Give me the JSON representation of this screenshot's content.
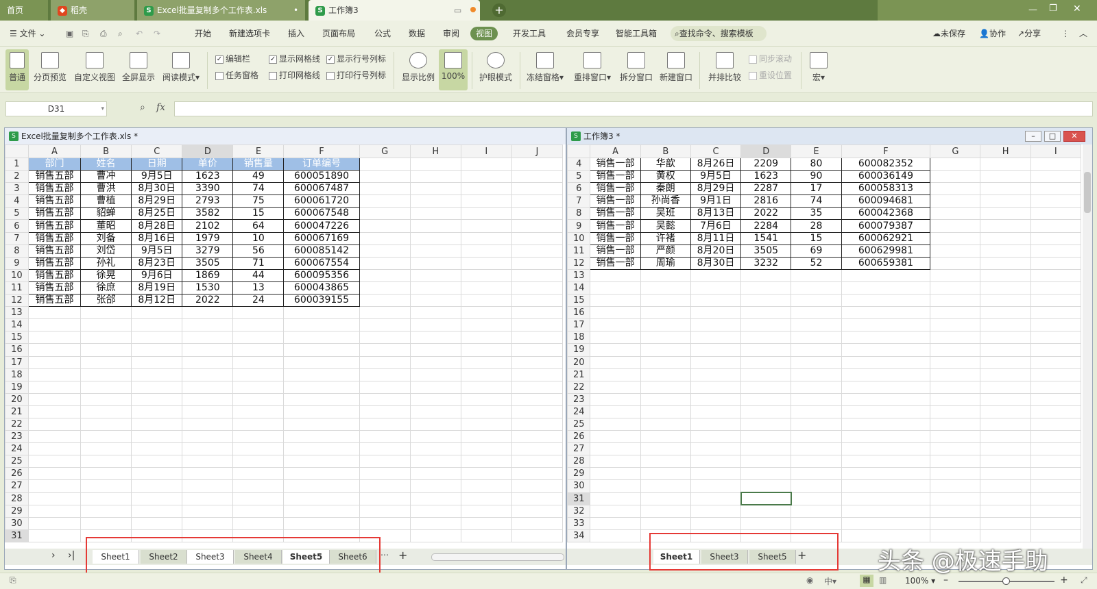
{
  "tabs": [
    {
      "label": "首页"
    },
    {
      "label": "稻壳"
    },
    {
      "label": "Excel批量复制多个工作表.xls"
    },
    {
      "label": "工作簿3"
    }
  ],
  "menu": [
    "文件",
    "开始",
    "新建选项卡",
    "插入",
    "页面布局",
    "公式",
    "数据",
    "审阅",
    "视图",
    "开发工具",
    "会员专享",
    "智能工具箱"
  ],
  "menu_active": "视图",
  "search_label": "查找命令、搜索模板",
  "right_actions": [
    "未保存",
    "协作",
    "分享"
  ],
  "ribbon": {
    "buttons": [
      "普通",
      "分页预览",
      "自定义视图",
      "全屏显示",
      "阅读模式",
      "显示比例",
      "100%",
      "护眼模式",
      "冻结窗格",
      "重排窗口",
      "拆分窗口",
      "新建窗口",
      "并排比较",
      "宏"
    ],
    "checks": [
      {
        "label": "编辑栏",
        "checked": true
      },
      {
        "label": "显示网格线",
        "checked": true
      },
      {
        "label": "显示行号列标",
        "checked": true
      },
      {
        "label": "任务窗格",
        "checked": false
      },
      {
        "label": "打印网格线",
        "checked": false
      },
      {
        "label": "打印行号列标",
        "checked": false
      }
    ],
    "disabled": [
      "同步滚动",
      "重设位置"
    ]
  },
  "namebox": "D31",
  "fx": "fx",
  "left_window": {
    "title": "Excel批量复制多个工作表.xls *",
    "columns": [
      "A",
      "B",
      "C",
      "D",
      "E",
      "F",
      "G",
      "H",
      "I",
      "J"
    ],
    "headers": [
      "部门",
      "姓名",
      "日期",
      "单价",
      "销售量",
      "订单编号"
    ],
    "rows": [
      [
        "销售五部",
        "曹冲",
        "9月5日",
        "1623",
        "49",
        "600051890"
      ],
      [
        "销售五部",
        "曹洪",
        "8月30日",
        "3390",
        "74",
        "600067487"
      ],
      [
        "销售五部",
        "曹植",
        "8月29日",
        "2793",
        "75",
        "600061720"
      ],
      [
        "销售五部",
        "貂蝉",
        "8月25日",
        "3582",
        "15",
        "600067548"
      ],
      [
        "销售五部",
        "董昭",
        "8月28日",
        "2102",
        "64",
        "600047226"
      ],
      [
        "销售五部",
        "刘备",
        "8月16日",
        "1979",
        "10",
        "600067169"
      ],
      [
        "销售五部",
        "刘岱",
        "9月5日",
        "3279",
        "56",
        "600085142"
      ],
      [
        "销售五部",
        "孙礼",
        "8月23日",
        "3505",
        "71",
        "600067554"
      ],
      [
        "销售五部",
        "徐晃",
        "9月6日",
        "1869",
        "44",
        "600095356"
      ],
      [
        "销售五部",
        "徐庶",
        "8月19日",
        "1530",
        "13",
        "600043865"
      ],
      [
        "销售五部",
        "张郃",
        "8月12日",
        "2022",
        "24",
        "600039155"
      ]
    ],
    "sheets": [
      "Sheet1",
      "Sheet2",
      "Sheet3",
      "Sheet4",
      "Sheet5",
      "Sheet6"
    ],
    "active_sheet": "Sheet5"
  },
  "right_window": {
    "title": "工作簿3 *",
    "columns": [
      "A",
      "B",
      "C",
      "D",
      "E",
      "F",
      "G",
      "H",
      "I"
    ],
    "first_row": 4,
    "rows": [
      [
        "销售一部",
        "华歆",
        "8月26日",
        "2209",
        "80",
        "600082352"
      ],
      [
        "销售一部",
        "黄权",
        "9月5日",
        "1623",
        "90",
        "600036149"
      ],
      [
        "销售一部",
        "秦朗",
        "8月29日",
        "2287",
        "17",
        "600058313"
      ],
      [
        "销售一部",
        "孙尚香",
        "9月1日",
        "2816",
        "74",
        "600094681"
      ],
      [
        "销售一部",
        "吴班",
        "8月13日",
        "2022",
        "35",
        "600042368"
      ],
      [
        "销售一部",
        "吴懿",
        "7月6日",
        "2284",
        "28",
        "600079387"
      ],
      [
        "销售一部",
        "许褚",
        "8月11日",
        "1541",
        "15",
        "600062921"
      ],
      [
        "销售一部",
        "严颜",
        "8月20日",
        "3505",
        "69",
        "600629981"
      ],
      [
        "销售一部",
        "周瑜",
        "8月30日",
        "3232",
        "52",
        "600659381"
      ]
    ],
    "sheets": [
      "Sheet1",
      "Sheet3",
      "Sheet5"
    ],
    "active_sheet": "Sheet1"
  },
  "status": {
    "zoom": "100%"
  },
  "watermark": "头条 @极速手助"
}
